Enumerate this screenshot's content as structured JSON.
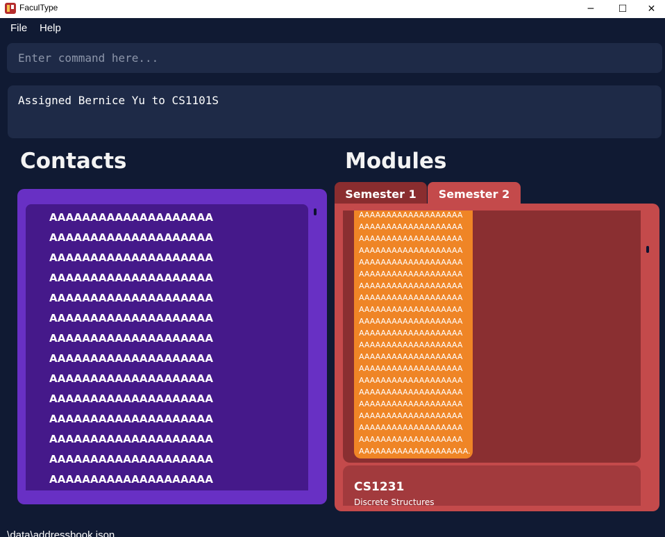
{
  "window": {
    "title": "FaculType",
    "minimize_glyph": "─",
    "maximize_glyph": "☐",
    "close_glyph": "✕"
  },
  "menu": {
    "items": [
      {
        "label": "File"
      },
      {
        "label": "Help"
      }
    ]
  },
  "command": {
    "placeholder": "Enter command here...",
    "value": ""
  },
  "result": {
    "text": "Assigned Bernice Yu to CS1101S"
  },
  "contacts": {
    "heading": "Contacts",
    "rows": [
      "AAAAAAAAAAAAAAAAAAAA",
      "AAAAAAAAAAAAAAAAAAAA",
      "AAAAAAAAAAAAAAAAAAAA",
      "AAAAAAAAAAAAAAAAAAAA",
      "AAAAAAAAAAAAAAAAAAAA",
      "AAAAAAAAAAAAAAAAAAAA",
      "AAAAAAAAAAAAAAAAAAAA",
      "AAAAAAAAAAAAAAAAAAAA",
      "AAAAAAAAAAAAAAAAAAAA",
      "AAAAAAAAAAAAAAAAAAAA",
      "AAAAAAAAAAAAAAAAAAAA",
      "AAAAAAAAAAAAAAAAAAAA",
      "AAAAAAAAAAAAAAAAAAAA",
      "AAAAAAAAAAAAAAAAAAAA"
    ]
  },
  "modules": {
    "heading": "Modules",
    "tabs": [
      {
        "label": "Semester 1",
        "selected": false
      },
      {
        "label": "Semester 2",
        "selected": true
      }
    ],
    "card1_lines": [
      "AAAAAAAAAAAAAAAAAAA",
      "AAAAAAAAAAAAAAAAAAA",
      "AAAAAAAAAAAAAAAAAAA",
      "AAAAAAAAAAAAAAAAAAA",
      "AAAAAAAAAAAAAAAAAAA",
      "AAAAAAAAAAAAAAAAAAA",
      "AAAAAAAAAAAAAAAAAAA",
      "AAAAAAAAAAAAAAAAAAA",
      "AAAAAAAAAAAAAAAAAAA",
      "AAAAAAAAAAAAAAAAAAA",
      "AAAAAAAAAAAAAAAAAAA",
      "AAAAAAAAAAAAAAAAAAA",
      "AAAAAAAAAAAAAAAAAAA",
      "AAAAAAAAAAAAAAAAAAA",
      "AAAAAAAAAAAAAAAAAAA",
      "AAAAAAAAAAAAAAAAAAA",
      "AAAAAAAAAAAAAAAAAAA",
      "AAAAAAAAAAAAAAAAAAA",
      "AAAAAAAAAAAAAAAAAAA",
      "AAAAAAAAAAAAAAAAAAA",
      "AAAAAAAAAAAAAAAAAAAA."
    ],
    "card2": {
      "code": "CS1231",
      "name": "Discrete Structures"
    }
  },
  "statusbar": {
    "path": ".\\data\\addressbook.json"
  },
  "colors": {
    "background": "#101a33",
    "input_bg": "#1e2a47",
    "contacts_panel": "#6830c4",
    "contacts_list": "#45198a",
    "modules_panel": "#c44a4b",
    "tab_inactive": "#8a2d2f",
    "module_card": "#8a2f31",
    "module_card_alt": "#a23a3d",
    "accent_orange": "#ef8526"
  }
}
